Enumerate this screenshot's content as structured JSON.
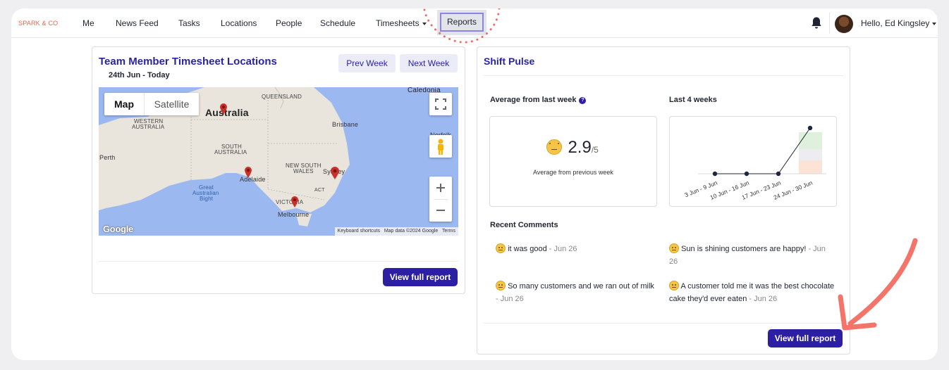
{
  "nav": {
    "brand": "SPARK & CO",
    "items": [
      "Me",
      "News Feed",
      "Tasks",
      "Locations",
      "People",
      "Schedule",
      "Timesheets",
      "Reports"
    ],
    "greeting": "Hello, Ed Kingsley"
  },
  "timesheet_card": {
    "title": "Team Member Timesheet Locations",
    "date_range": "24th Jun - Today",
    "prev_week": "Prev Week",
    "next_week": "Next Week",
    "view_full_report": "View full report",
    "map": {
      "map_button": "Map",
      "satellite_button": "Satellite",
      "labels": {
        "queensland": "QUEENSLAND",
        "caledonia": "Caledonia",
        "australia": "Australia",
        "western_australia_1": "WESTERN",
        "western_australia_2": "AUSTRALIA",
        "brisbane": "Brisbane",
        "south_australia_1": "SOUTH",
        "south_australia_2": "AUSTRALIA",
        "norfolk": "Norfolk",
        "perth": "Perth",
        "nsw_1": "NEW SOUTH",
        "nsw_2": "WALES",
        "sydney": "Sydney",
        "adelaide": "Adelaide",
        "act": "ACT",
        "gab_1": "Great",
        "gab_2": "Australian",
        "gab_3": "Bight",
        "victoria": "VICTORIA",
        "melbourne": "Melbourne"
      },
      "google": "Google",
      "attribution": [
        "Keyboard shortcuts",
        "Map data ©2024 Google",
        "Terms"
      ]
    }
  },
  "shift_pulse": {
    "title": "Shift Pulse",
    "average_label": "Average from last week",
    "last4_label": "Last 4 weeks",
    "score": "2.9",
    "score_max": "/5",
    "score_caption": "Average from previous week",
    "recent_comments_label": "Recent Comments",
    "comments": [
      {
        "text": "it was good",
        "date": " - Jun 26"
      },
      {
        "text": "Sun is shining customers are happy!",
        "date": " - Jun 26"
      },
      {
        "text": "So many customers and we ran out of milk",
        "date": " - Jun 26"
      },
      {
        "text": "A customer told me it was the best chocolate cake they'd ever eaten",
        "date": " - Jun 26"
      }
    ],
    "view_full_report": "View full report"
  },
  "chart_data": {
    "type": "line",
    "categories": [
      "3 Jun - 9 Jun",
      "10 Jun - 16 Jun",
      "17 Jun - 23 Jun",
      "24 Jun - 30 Jun"
    ],
    "values": [
      0,
      0,
      0,
      2.9
    ],
    "ylim": [
      0,
      5
    ],
    "grid": false,
    "colors": {
      "line": "#1f2430",
      "band_top": "#dff0dc",
      "band_mid": "#ececf1",
      "band_low": "#fbe3d6"
    }
  },
  "colors": {
    "accent": "#2d1fa3",
    "title": "#2a22a8",
    "annotation": "#f06b60",
    "brand": "#e8674f"
  }
}
